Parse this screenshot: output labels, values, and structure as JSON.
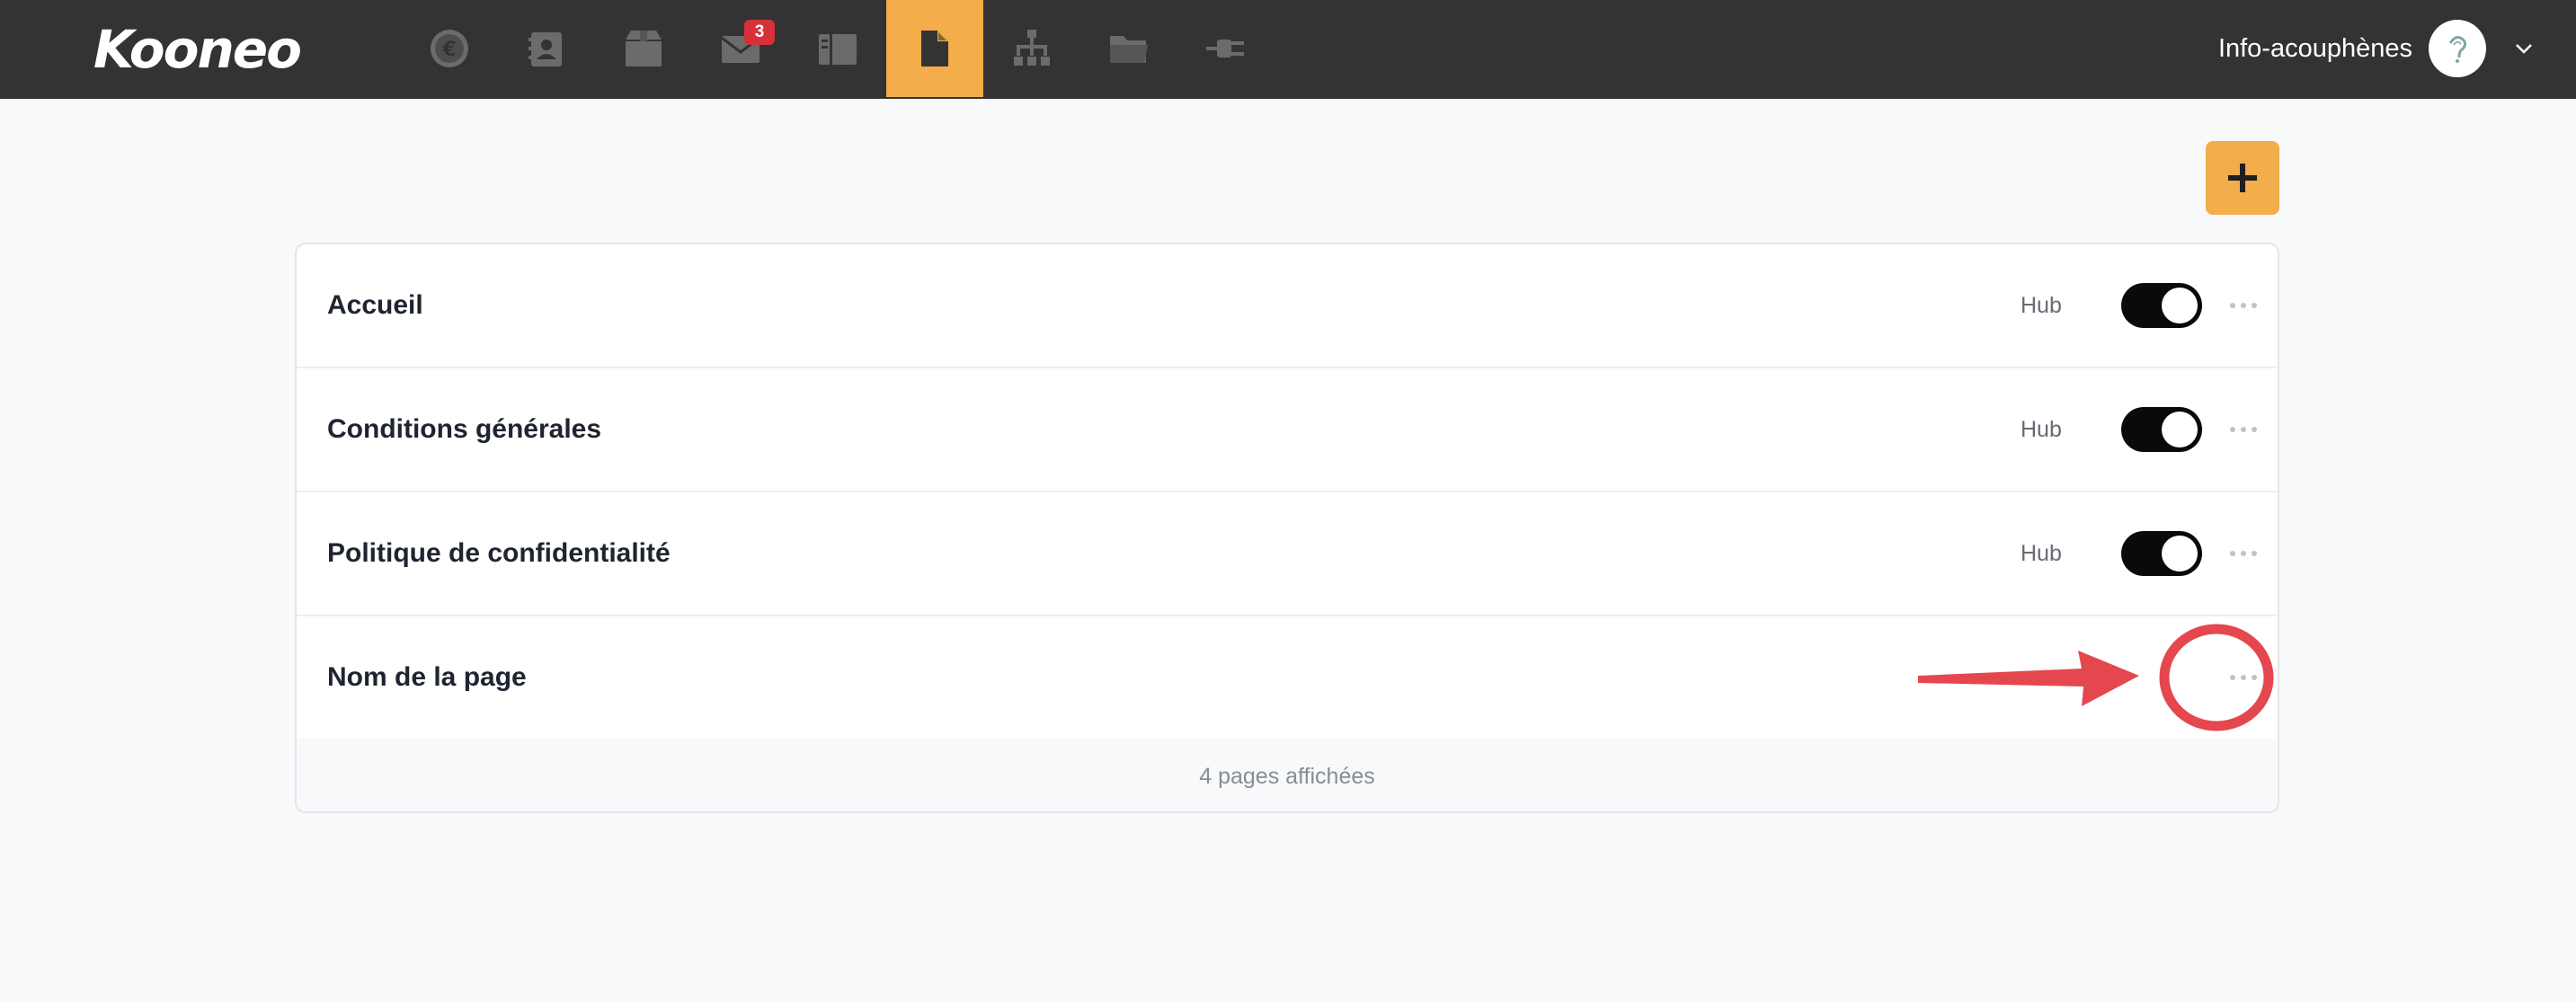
{
  "brand": {
    "logo_text": "Kooneo"
  },
  "nav": {
    "items": [
      {
        "icon": "euro-icon"
      },
      {
        "icon": "contacts-icon"
      },
      {
        "icon": "box-icon"
      },
      {
        "icon": "mail-icon",
        "badge": "3"
      },
      {
        "icon": "book-icon"
      },
      {
        "icon": "page-icon",
        "active": true
      },
      {
        "icon": "sitemap-icon"
      },
      {
        "icon": "folder-icon"
      },
      {
        "icon": "plug-icon"
      }
    ]
  },
  "account": {
    "name": "Info-acouphènes"
  },
  "colors": {
    "accent": "#f3ad4a",
    "topbar": "#333333",
    "badge": "#d6303b",
    "annotation": "#e5474f"
  },
  "pages": [
    {
      "title": "Accueil",
      "hub_label": "Hub",
      "hub_on": true
    },
    {
      "title": "Conditions générales",
      "hub_label": "Hub",
      "hub_on": true
    },
    {
      "title": "Politique de confidentialité",
      "hub_label": "Hub",
      "hub_on": true
    },
    {
      "title": "Nom de la page"
    }
  ],
  "footer": {
    "count_text": "4 pages affichées"
  }
}
